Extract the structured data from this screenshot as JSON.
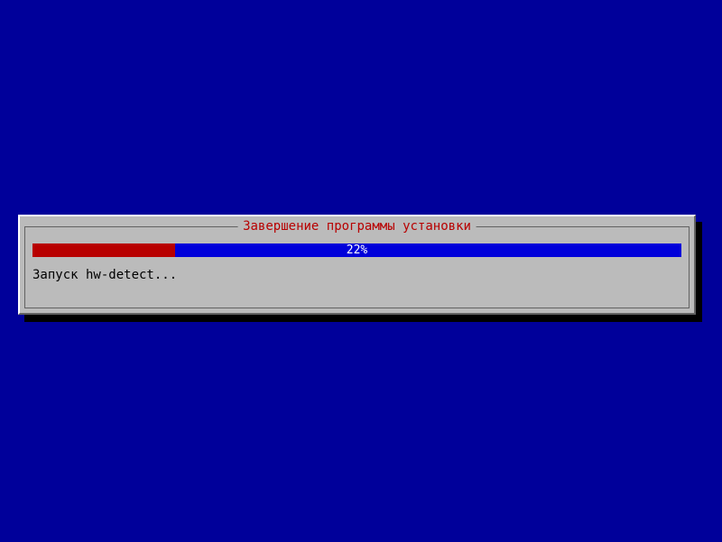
{
  "dialog": {
    "title": "Завершение программы установки",
    "progress": {
      "percent": 22,
      "percent_label": "22%"
    },
    "status": "Запуск hw-detect..."
  },
  "colors": {
    "background": "#00009a",
    "dialog_bg": "#bbbbbb",
    "progress_fill": "#b80000",
    "progress_bg": "#0000da",
    "title_color": "#b80000"
  }
}
